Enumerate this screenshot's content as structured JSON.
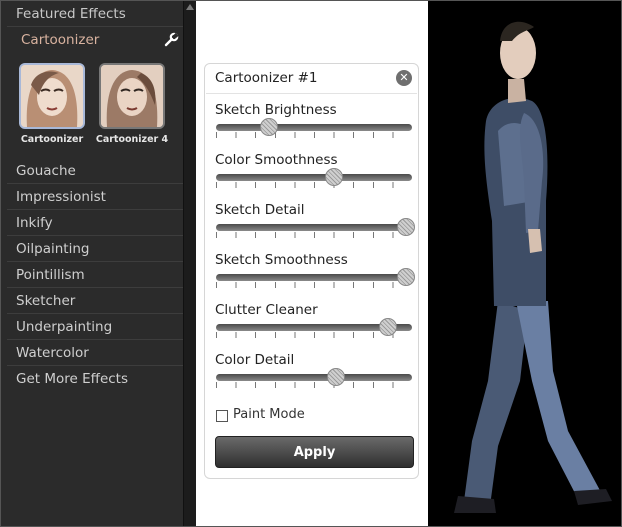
{
  "sidebar": {
    "header": "Featured Effects",
    "active_effect": "Cartoonizer",
    "presets": [
      {
        "label": "Cartoonizer",
        "selected": true
      },
      {
        "label": "Cartoonizer 4",
        "selected": false
      }
    ],
    "items": [
      "Gouache",
      "Impressionist",
      "Inkify",
      "Oilpainting",
      "Pointillism",
      "Sketcher",
      "Underpainting",
      "Watercolor",
      "Get More Effects"
    ]
  },
  "panel": {
    "title": "Cartoonizer #1",
    "sliders": [
      {
        "label": "Sketch Brightness",
        "value": 0.27
      },
      {
        "label": "Color Smoothness",
        "value": 0.6
      },
      {
        "label": "Sketch Detail",
        "value": 0.97
      },
      {
        "label": "Sketch Smoothness",
        "value": 0.97
      },
      {
        "label": "Clutter Cleaner",
        "value": 0.88
      },
      {
        "label": "Color Detail",
        "value": 0.61
      }
    ],
    "paint_mode_label": "Paint Mode",
    "paint_mode_checked": false,
    "apply_label": "Apply"
  },
  "colors": {
    "sidebar_bg": "#2b2b2b",
    "active_text": "#d9b3a0",
    "photo_bg": "#000000"
  }
}
